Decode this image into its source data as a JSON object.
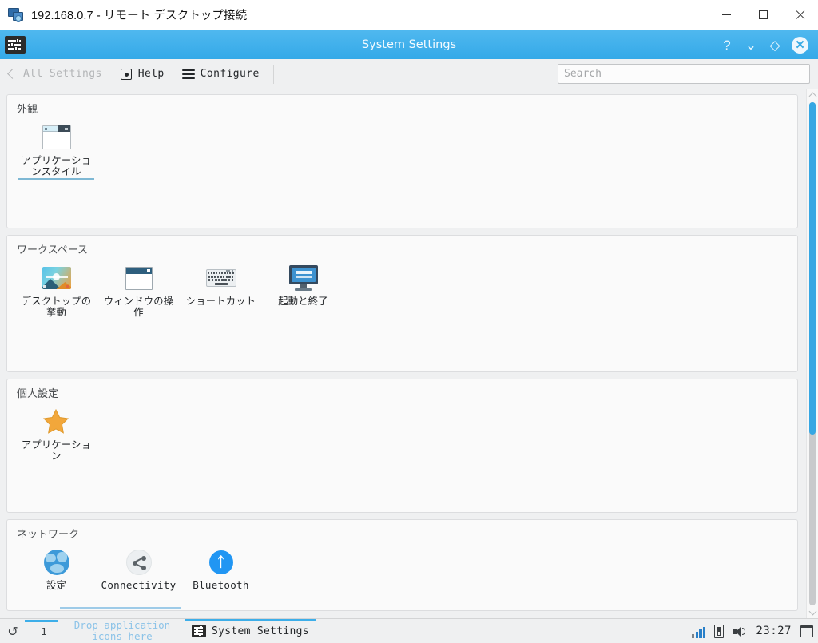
{
  "rdp_window": {
    "title": "192.168.0.7 - リモート デスクトップ接続",
    "icon": "remote-desktop-icon",
    "controls": {
      "minimize": "—",
      "maximize": "□",
      "close": "✕"
    }
  },
  "kde_window": {
    "title": "System Settings",
    "app_icon": "system-settings-icon",
    "titlebar_color": "#3daee9",
    "buttons": {
      "help": "?",
      "minimize": "⌄",
      "maximize": "◇",
      "close": "✕"
    }
  },
  "toolbar": {
    "back_label": "All Settings",
    "back_icon": "chevron-left-icon",
    "back_disabled": true,
    "help_label": "Help",
    "help_icon": "khelp-icon",
    "configure_label": "Configure",
    "configure_icon": "hamburger-icon",
    "search_placeholder": "Search",
    "search_value": ""
  },
  "categories": [
    {
      "title": "外観",
      "name": "appearance",
      "items": [
        {
          "label": "アプリケーションスタイル",
          "icon": "application-style-icon",
          "selected": true,
          "latin": false
        }
      ]
    },
    {
      "title": "ワークスペース",
      "name": "workspace",
      "items": [
        {
          "label": "デスクトップの挙動",
          "icon": "desktop-behavior-icon",
          "selected": false,
          "latin": false
        },
        {
          "label": "ウィンドウの操作",
          "icon": "window-management-icon",
          "selected": false,
          "latin": false
        },
        {
          "label": "ショートカット",
          "icon": "keyboard-shortcuts-icon",
          "selected": false,
          "latin": false
        },
        {
          "label": "起動と終了",
          "icon": "startup-shutdown-icon",
          "selected": false,
          "latin": false
        }
      ]
    },
    {
      "title": "個人設定",
      "name": "personalization",
      "items": [
        {
          "label": "アプリケーション",
          "icon": "star-applications-icon",
          "selected": false,
          "latin": false
        }
      ]
    },
    {
      "title": "ネットワーク",
      "name": "network",
      "items": [
        {
          "label": "設定",
          "icon": "globe-settings-icon",
          "selected": false,
          "latin": false
        },
        {
          "label": "Connectivity",
          "icon": "connectivity-icon",
          "selected": false,
          "latin": true
        },
        {
          "label": "Bluetooth",
          "icon": "bluetooth-icon",
          "selected": false,
          "latin": true
        }
      ]
    }
  ],
  "scrollbar": {
    "thumb_percent": 66,
    "up_icon": "chevron-up-icon",
    "down_icon": "chevron-down-icon"
  },
  "taskbar": {
    "pager_icon": "pager-icon",
    "desktop_number": "1",
    "drop_hint": "Drop application icons here",
    "task": {
      "label": "System Settings",
      "icon": "system-settings-icon"
    },
    "tray": {
      "network_icon": "network-signal-icon",
      "device_icon": "usb-device-icon",
      "volume_icon": "volume-icon",
      "clock": "23:27",
      "show_desktop_icon": "show-desktop-icon"
    }
  }
}
